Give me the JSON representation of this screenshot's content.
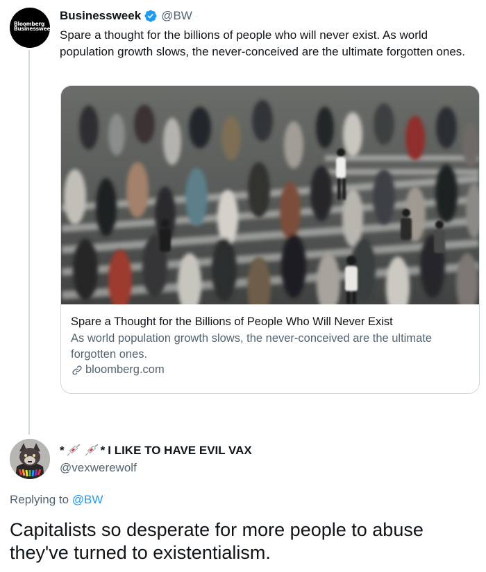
{
  "tweet": {
    "author": {
      "display_name": "Businessweek",
      "handle": "@BW",
      "verified": true,
      "avatar_text": "Bloomberg Businessweek"
    },
    "text": "Spare a thought for the billions of people who will never exist. As world population growth slows, the never-conceived are the ultimate forgotten ones.",
    "card": {
      "title": "Spare a Thought for the Billions of People Who Will Never Exist",
      "description": "As world population growth slows, the never-conceived are the ultimate forgotten ones.",
      "domain": "bloomberg.com",
      "icon": "link-icon"
    }
  },
  "reply": {
    "author": {
      "name_prefix": "*",
      "name_middle": "*",
      "name_text": "I LIKE TO HAVE EVIL VAX",
      "handle": "@vexwerewolf",
      "emoji_icon": "syringe-icon"
    },
    "replying_to_label": "Replying to",
    "replying_to_handle": "@BW",
    "text": "Capitalists so desperate for more people to abuse they've turned to existentialism."
  },
  "colors": {
    "text": "#0f1419",
    "secondary": "#536471",
    "accent": "#1d9bf0",
    "border": "#cfd9de"
  }
}
